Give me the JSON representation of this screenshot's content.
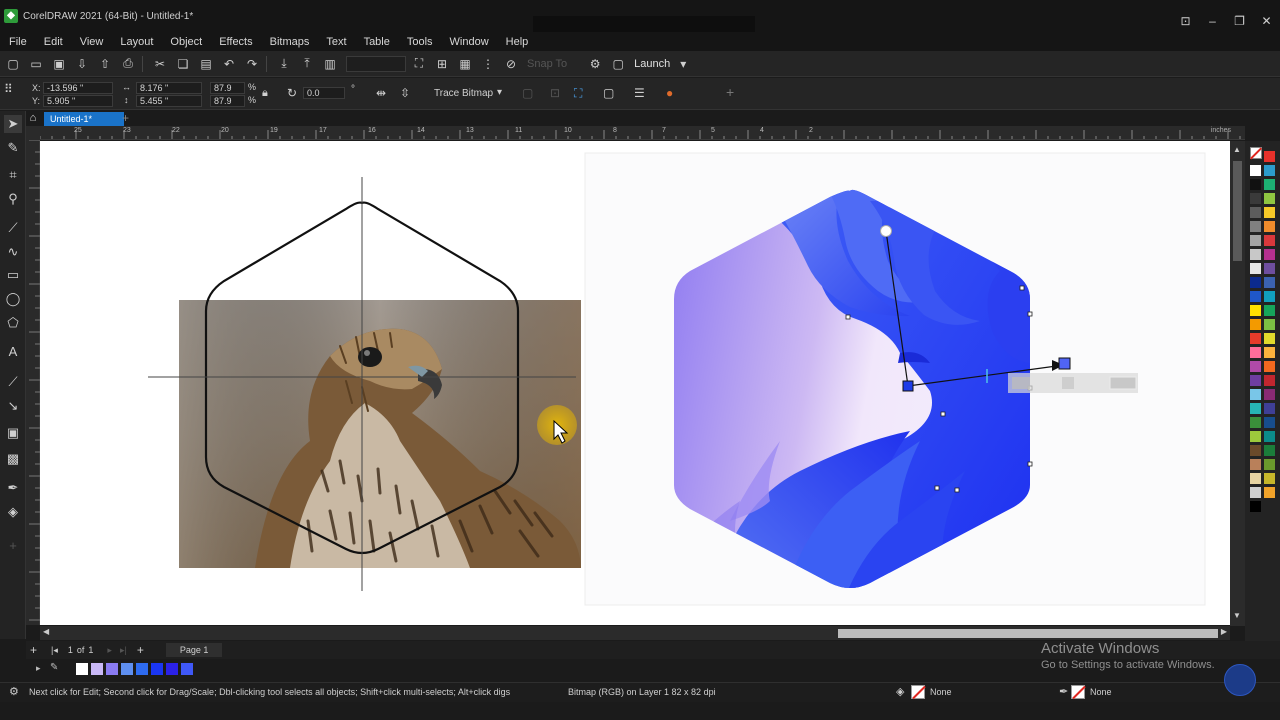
{
  "window": {
    "title": "CorelDRAW 2021 (64-Bit) - Untitled-1*",
    "app_icon": "coreldraw-icon",
    "controls": [
      "notify-icon",
      "minimize-icon",
      "restore-icon",
      "close-icon"
    ]
  },
  "menu": [
    "File",
    "Edit",
    "View",
    "Layout",
    "Object",
    "Effects",
    "Bitmaps",
    "Text",
    "Table",
    "Tools",
    "Window",
    "Help"
  ],
  "toolbar": {
    "zoom_value": "",
    "snap_label": "Snap To",
    "launch_label": "Launch"
  },
  "property_bar": {
    "x_label": "X:",
    "x_value": "-13.596 \"",
    "y_label": "Y:",
    "y_value": "5.905 \"",
    "width_value": "8.176 \"",
    "height_value": "5.455 \"",
    "scale_w": "87.9",
    "scale_h": "87.9",
    "percent": "%",
    "rotation_value": "0.0",
    "rotation_unit": "°",
    "trace_label": "Trace Bitmap"
  },
  "tabs": {
    "document": "Untitled-1*"
  },
  "ruler": {
    "ticks": [
      "25",
      "23",
      "22",
      "20",
      "19",
      "17",
      "16",
      "14",
      "13",
      "11",
      "10",
      "8",
      "7",
      "5",
      "4",
      "2"
    ],
    "unit": "inches"
  },
  "pages": {
    "counter": "1",
    "of": "of",
    "total": "1",
    "page_tab": "Page 1"
  },
  "document_palette": [
    "#ffffff",
    "#c9b8f6",
    "#8a7bf2",
    "#5e8ff0",
    "#2e6bf0",
    "#1a36f2",
    "#2b21e8",
    "#3f58f7"
  ],
  "status": {
    "hint": "Next click for Edit; Second click for Drag/Scale; Dbl-clicking tool selects all objects; Shift+click multi-selects; Alt+click digs",
    "object_info": "Bitmap (RGB) on Layer 1 82 x 82 dpi",
    "fill_label": "None",
    "outline_label": "None"
  },
  "activation": {
    "title": "Activate Windows",
    "subtitle": "Go to Settings to activate Windows."
  },
  "colors": {
    "accent": "#1a73c9",
    "gradient_light": "#e9dcf6",
    "gradient_mid": "#8b73ef",
    "gradient_deep": "#1f34f2"
  }
}
